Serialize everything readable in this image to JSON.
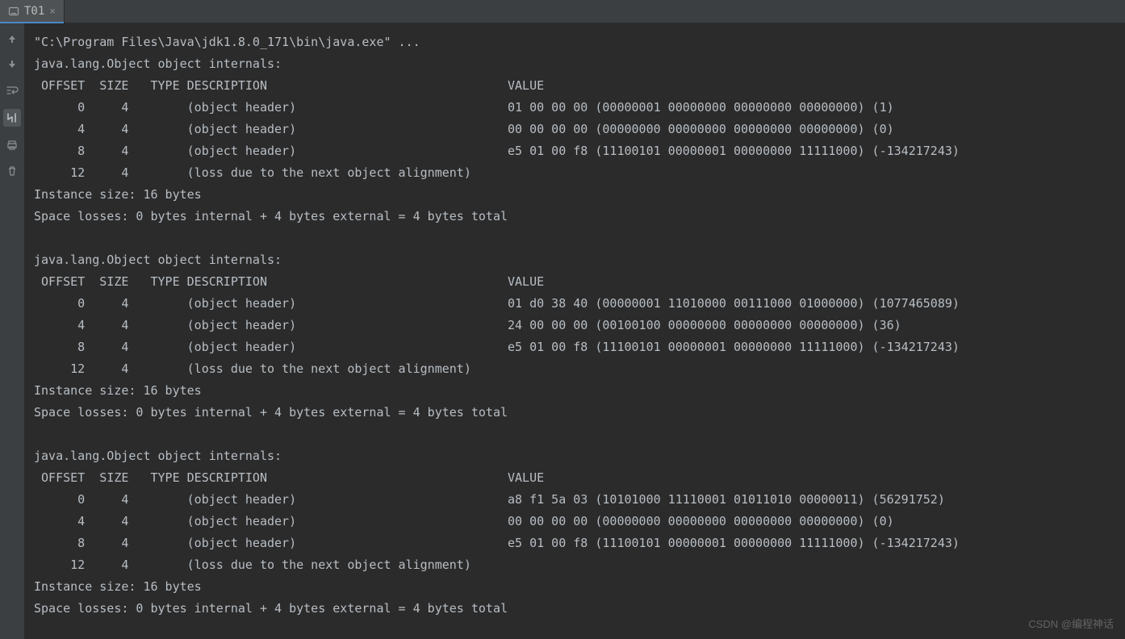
{
  "tabs": [
    {
      "label": "T01"
    }
  ],
  "gutter_icons": [
    "up",
    "down",
    "soft-wrap",
    "scroll-to-end",
    "print",
    "trash"
  ],
  "console": {
    "command": "\"C:\\Program Files\\Java\\jdk1.8.0_171\\bin\\java.exe\" ...",
    "blocks": [
      {
        "title": "java.lang.Object object internals:",
        "columns": [
          "OFFSET",
          "SIZE",
          "TYPE",
          "DESCRIPTION",
          "VALUE"
        ],
        "rows": [
          {
            "offset": 0,
            "size": 4,
            "type": "",
            "description": "(object header)",
            "value": "01 00 00 00 (00000001 00000000 00000000 00000000) (1)"
          },
          {
            "offset": 4,
            "size": 4,
            "type": "",
            "description": "(object header)",
            "value": "00 00 00 00 (00000000 00000000 00000000 00000000) (0)"
          },
          {
            "offset": 8,
            "size": 4,
            "type": "",
            "description": "(object header)",
            "value": "e5 01 00 f8 (11100101 00000001 00000000 11111000) (-134217243)"
          },
          {
            "offset": 12,
            "size": 4,
            "type": "",
            "description": "(loss due to the next object alignment)",
            "value": ""
          }
        ],
        "instance_size": "Instance size: 16 bytes",
        "space_losses": "Space losses: 0 bytes internal + 4 bytes external = 4 bytes total"
      },
      {
        "title": "java.lang.Object object internals:",
        "columns": [
          "OFFSET",
          "SIZE",
          "TYPE",
          "DESCRIPTION",
          "VALUE"
        ],
        "rows": [
          {
            "offset": 0,
            "size": 4,
            "type": "",
            "description": "(object header)",
            "value": "01 d0 38 40 (00000001 11010000 00111000 01000000) (1077465089)"
          },
          {
            "offset": 4,
            "size": 4,
            "type": "",
            "description": "(object header)",
            "value": "24 00 00 00 (00100100 00000000 00000000 00000000) (36)"
          },
          {
            "offset": 8,
            "size": 4,
            "type": "",
            "description": "(object header)",
            "value": "e5 01 00 f8 (11100101 00000001 00000000 11111000) (-134217243)"
          },
          {
            "offset": 12,
            "size": 4,
            "type": "",
            "description": "(loss due to the next object alignment)",
            "value": ""
          }
        ],
        "instance_size": "Instance size: 16 bytes",
        "space_losses": "Space losses: 0 bytes internal + 4 bytes external = 4 bytes total"
      },
      {
        "title": "java.lang.Object object internals:",
        "columns": [
          "OFFSET",
          "SIZE",
          "TYPE",
          "DESCRIPTION",
          "VALUE"
        ],
        "rows": [
          {
            "offset": 0,
            "size": 4,
            "type": "",
            "description": "(object header)",
            "value": "a8 f1 5a 03 (10101000 11110001 01011010 00000011) (56291752)"
          },
          {
            "offset": 4,
            "size": 4,
            "type": "",
            "description": "(object header)",
            "value": "00 00 00 00 (00000000 00000000 00000000 00000000) (0)"
          },
          {
            "offset": 8,
            "size": 4,
            "type": "",
            "description": "(object header)",
            "value": "e5 01 00 f8 (11100101 00000001 00000000 11111000) (-134217243)"
          },
          {
            "offset": 12,
            "size": 4,
            "type": "",
            "description": "(loss due to the next object alignment)",
            "value": ""
          }
        ],
        "instance_size": "Instance size: 16 bytes",
        "space_losses": "Space losses: 0 bytes internal + 4 bytes external = 4 bytes total"
      }
    ],
    "text": ""
  },
  "watermark": "CSDN @编程神话"
}
